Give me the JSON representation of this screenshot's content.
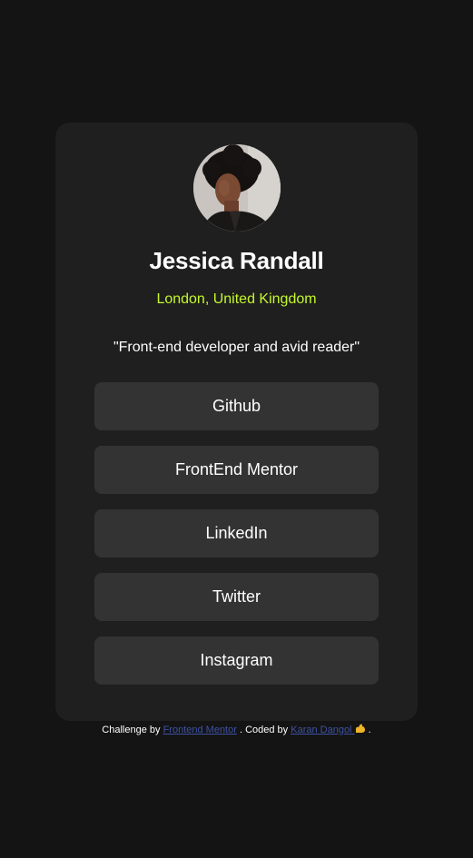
{
  "profile": {
    "name": "Jessica Randall",
    "location": "London, United Kingdom",
    "bio": "\"Front-end developer and avid reader\"",
    "avatar_icon": "portrait-photo"
  },
  "links": [
    {
      "label": "Github"
    },
    {
      "label": "FrontEnd Mentor"
    },
    {
      "label": "LinkedIn"
    },
    {
      "label": "Twitter"
    },
    {
      "label": "Instagram"
    }
  ],
  "footer": {
    "challenge_prefix": "Challenge by",
    "challenge_link": "Frontend Mentor",
    "coded_prefix": ". Coded by",
    "coder_link": "Karan Dangol",
    "suffix": "."
  },
  "colors": {
    "page_background": "#141414",
    "card_background": "#1f1f1f",
    "button_background": "#333333",
    "accent_green": "#c4f82a",
    "link_blue": "#3e52a3"
  }
}
